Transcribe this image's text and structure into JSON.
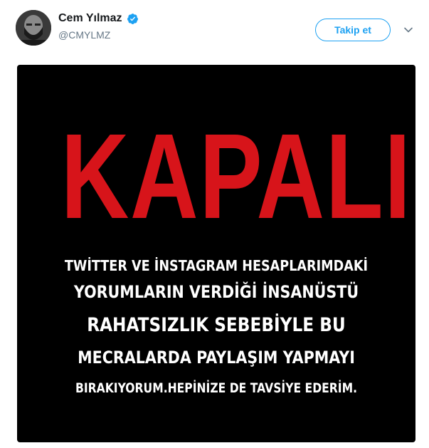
{
  "user": {
    "display_name": "Cem Yılmaz",
    "handle": "@CMYLMZ",
    "verified": true
  },
  "follow_button": {
    "label": "Takip et"
  },
  "icons": {
    "verified": "verified-badge-icon",
    "more": "chevron-down-icon"
  },
  "colors": {
    "accent": "#1da1f2",
    "image_background": "#000000",
    "headline": "#d7141a",
    "message_text": "#ffffff"
  },
  "media": {
    "headline": "KAPALI",
    "message_lines": [
      "TWİTTER VE İNSTAGRAM HESAPLARIMDAKİ",
      "YORUMLARIN VERDİĞİ İNSANÜSTÜ",
      "RAHATSIZLIK SEBEBİYLE BU",
      "MECRALARDA PAYLAŞIM YAPMAYI",
      "BIRAKIYORUM.HEPİNİZE DE TAVSİYE EDERİM."
    ]
  }
}
